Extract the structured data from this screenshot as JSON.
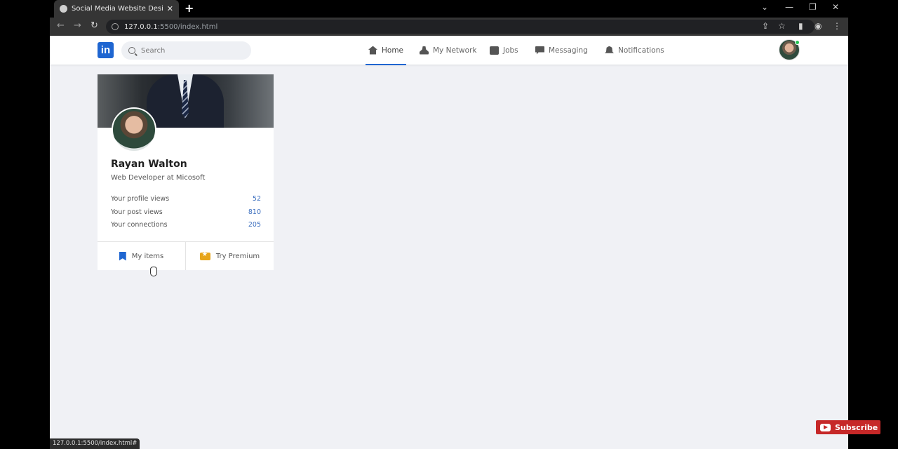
{
  "browser": {
    "tab_title": "Social Media Website Design - E",
    "url_host": "127.0.0.1",
    "url_path": ":5500/index.html",
    "status_url": "127.0.0.1:5500/index.html#"
  },
  "header": {
    "logo_text": "in",
    "search_placeholder": "Search",
    "nav": [
      {
        "label": "Home",
        "icon": "home-icon",
        "active": true
      },
      {
        "label": "My Network",
        "icon": "user-icon"
      },
      {
        "label": "Jobs",
        "icon": "briefcase-icon"
      },
      {
        "label": "Messaging",
        "icon": "message-icon"
      },
      {
        "label": "Notifications",
        "icon": "bell-icon"
      }
    ]
  },
  "profile": {
    "name": "Rayan Walton",
    "role": "Web Developer at Micosoft",
    "stats": [
      {
        "label": "Your profile views",
        "value": "52"
      },
      {
        "label": "Your post views",
        "value": "810"
      },
      {
        "label": "Your connections",
        "value": "205"
      }
    ],
    "footer": {
      "items_label": "My items",
      "premium_label": "Try Premium"
    }
  },
  "overlay": {
    "subscribe_label": "Subscribe"
  },
  "colors": {
    "brand": "#1f66d1",
    "page_bg": "#f0f1f5",
    "stat_value": "#3c6fbf",
    "premium": "#e7a51b"
  }
}
